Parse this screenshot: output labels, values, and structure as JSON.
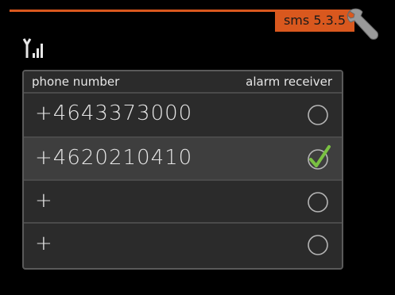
{
  "menu": {
    "label": "sms 5.3.5"
  },
  "icons": {
    "wrench": "wrench-icon",
    "signal": "signal-strength-icon",
    "check": "checkmark-icon"
  },
  "colors": {
    "accent": "#d9581e",
    "check": "#7ac142"
  },
  "table": {
    "col_phone": "phone number",
    "col_alarm": "alarm receiver",
    "rows": [
      {
        "number": "+4643373000",
        "alarm_receiver": false
      },
      {
        "number": "+4620210410",
        "alarm_receiver": true
      },
      {
        "number": "+",
        "alarm_receiver": false
      },
      {
        "number": "+",
        "alarm_receiver": false
      }
    ]
  }
}
